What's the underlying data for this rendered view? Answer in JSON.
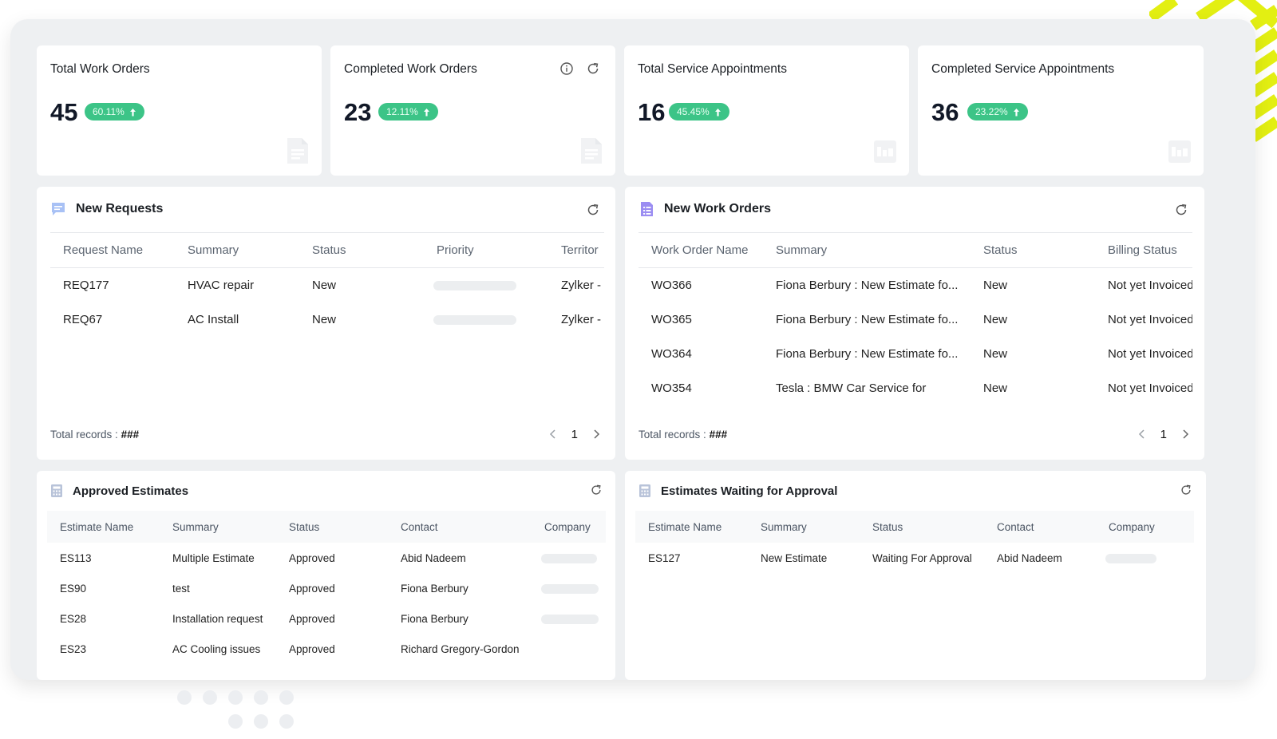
{
  "colors": {
    "accent_green": "#3cc487",
    "brand_yellow": "#e3ef12",
    "icon_blue": "#5b8def",
    "icon_purple": "#7c6cf0"
  },
  "stats": [
    {
      "title": "Total Work Orders",
      "value": "45",
      "change": "60.11%",
      "trend": "up",
      "icon": "document-icon"
    },
    {
      "title": "Completed Work Orders",
      "value": "23",
      "change": "12.11%",
      "trend": "up",
      "icon": "document-icon"
    },
    {
      "title": "Total Service Appointments",
      "value": "16",
      "change": "45.45%",
      "trend": "up",
      "icon": "calendar-icon"
    },
    {
      "title": "Completed Service Appointments",
      "value": "36",
      "change": "23.22%",
      "trend": "up",
      "icon": "calendar-icon"
    }
  ],
  "new_requests": {
    "title": "New Requests",
    "icon": "chat-icon",
    "columns": [
      "Request Name",
      "Summary",
      "Status",
      "Priority",
      "Territor"
    ],
    "rows": [
      {
        "name": "REQ177",
        "summary": "HVAC repair",
        "status": "New",
        "territory": "Zylker -"
      },
      {
        "name": "REQ67",
        "summary": "AC Install",
        "status": "New",
        "territory": "Zylker -"
      }
    ],
    "total_label": "Total records :",
    "total_value": "###",
    "page": "1"
  },
  "new_work_orders": {
    "title": "New Work Orders",
    "icon": "list-document-icon",
    "columns": [
      "Work Order Name",
      "Summary",
      "Status",
      "Billing Status"
    ],
    "rows": [
      {
        "name": "WO366",
        "summary": "Fiona Berbury : New Estimate fo...",
        "status": "New",
        "billing": "Not yet Invoiced"
      },
      {
        "name": "WO365",
        "summary": "Fiona Berbury : New Estimate fo...",
        "status": "New",
        "billing": "Not yet Invoiced"
      },
      {
        "name": "WO364",
        "summary": "Fiona Berbury : New Estimate fo...",
        "status": "New",
        "billing": "Not yet Invoiced"
      },
      {
        "name": "WO354",
        "summary": "Tesla : BMW Car Service for",
        "status": "New",
        "billing": "Not yet Invoiced"
      }
    ],
    "total_label": "Total records :",
    "total_value": "###",
    "page": "1"
  },
  "approved_estimates": {
    "title": "Approved Estimates",
    "icon": "calculator-icon",
    "columns": [
      "Estimate Name",
      "Summary",
      "Status",
      "Contact",
      "Company"
    ],
    "rows": [
      {
        "name": "ES113",
        "summary": "Multiple Estimate",
        "status": "Approved",
        "contact": "Abid Nadeem"
      },
      {
        "name": "ES90",
        "summary": "test",
        "status": "Approved",
        "contact": "Fiona Berbury"
      },
      {
        "name": "ES28",
        "summary": "Installation request",
        "status": "Approved",
        "contact": "Fiona Berbury"
      },
      {
        "name": "ES23",
        "summary": "AC Cooling issues",
        "status": "Approved",
        "contact": "Richard Gregory-Gordon"
      }
    ]
  },
  "estimates_waiting": {
    "title": "Estimates Waiting for Approval",
    "icon": "calculator-icon",
    "columns": [
      "Estimate Name",
      "Summary",
      "Status",
      "Contact",
      "Company"
    ],
    "rows": [
      {
        "name": "ES127",
        "summary": "New Estimate",
        "status": "Waiting For Approval",
        "contact": "Abid Nadeem"
      }
    ]
  }
}
